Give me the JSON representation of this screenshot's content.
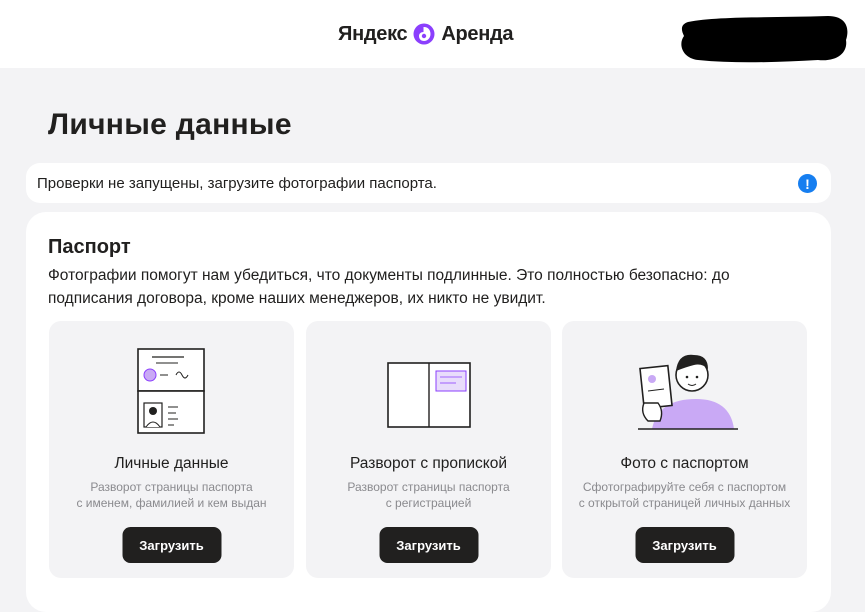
{
  "header": {
    "logo_text_left": "Яндекс",
    "logo_text_right": "Аренда",
    "logo_icon": "yandex-arenda-logo-icon",
    "redacted_area": "user-menu"
  },
  "page": {
    "title": "Личные данные"
  },
  "notice": {
    "text": "Проверки не запущены, загрузите фотографии паспорта.",
    "icon": "info-exclamation-icon",
    "icon_glyph": "!",
    "icon_color": "#167ef0"
  },
  "passport": {
    "title": "Паспорт",
    "description": "Фотографии помогут нам убедиться, что документы подлинные. Это полностью безопасно: до подписания договора, кроме наших менеджеров, их никто не увидит.",
    "tiles": [
      {
        "title": "Личные данные",
        "subtitle_line1": "Разворот страницы паспорта",
        "subtitle_line2": "с именем, фамилией и кем выдан",
        "button": "Загрузить",
        "icon": "passport-personal-page-icon"
      },
      {
        "title": "Разворот с пропиской",
        "subtitle_line1": "Разворот страницы паспорта",
        "subtitle_line2": "с регистрацией",
        "button": "Загрузить",
        "icon": "passport-registration-spread-icon"
      },
      {
        "title": "Фото с паспортом",
        "subtitle_line1": "Сфотографируйте себя с паспортом",
        "subtitle_line2": "с открытой страницей личных данных",
        "button": "Загрузить",
        "icon": "selfie-with-passport-icon"
      }
    ]
  },
  "colors": {
    "accent": "#8b3ffd",
    "button_bg": "#21201f",
    "page_bg": "#f3f3f5",
    "illustration_fill": "#c9a9f5"
  }
}
